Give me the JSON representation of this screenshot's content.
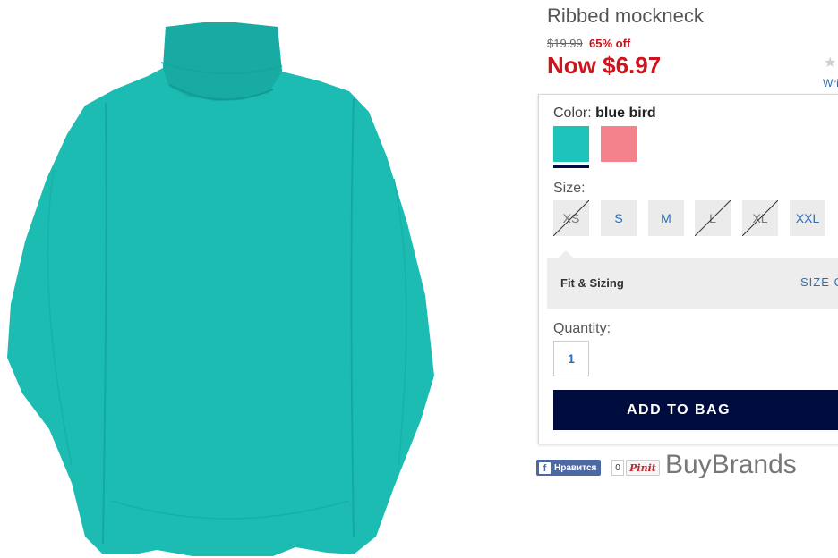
{
  "product": {
    "title": "Ribbed mockneck",
    "old_price": "$19.99",
    "discount": "65% off",
    "now_price": "Now $6.97",
    "image_icon": "turtleneck-shirt-image"
  },
  "reviews": {
    "star": "★",
    "write_label": "Wri"
  },
  "color": {
    "label": "Color:",
    "selected": "blue bird",
    "swatches": [
      "#1cc4bc",
      "#f4828d"
    ]
  },
  "size": {
    "label": "Size:",
    "options": [
      "XS",
      "S",
      "M",
      "L",
      "XL",
      "XXL"
    ],
    "unavailable": [
      "XS",
      "L",
      "XL"
    ]
  },
  "fit": {
    "label": "Fit & Sizing",
    "chart_link": "SIZE C"
  },
  "quantity": {
    "label": "Quantity:",
    "value": "1"
  },
  "actions": {
    "add_to_bag": "ADD TO BAG"
  },
  "social": {
    "like_label": "Нравится",
    "like_count": "0",
    "pin_label": "Pinit"
  },
  "watermark": "BuyBrands",
  "colors": {
    "accent_navy": "#000b3e",
    "sale_red": "#d0121c",
    "shirt_teal": "#1cc4bc"
  }
}
